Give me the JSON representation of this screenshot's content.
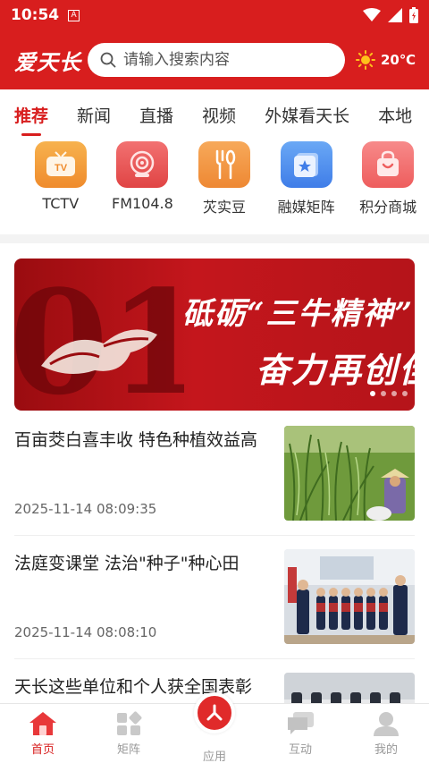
{
  "status_bar": {
    "time": "10:54",
    "notification_glyph": "A"
  },
  "header": {
    "logo_text": "爱天长",
    "search": {
      "placeholder": "请输入搜索内容",
      "value": ""
    },
    "weather": {
      "icon": "sun-icon",
      "temperature": "20℃"
    }
  },
  "tabs": [
    {
      "label": "推荐",
      "active": true
    },
    {
      "label": "新闻",
      "active": false
    },
    {
      "label": "直播",
      "active": false
    },
    {
      "label": "视频",
      "active": false
    },
    {
      "label": "外媒看天长",
      "active": false
    },
    {
      "label": "本地",
      "active": false
    }
  ],
  "apps": [
    {
      "label": "TCTV",
      "icon": "tv-icon",
      "color": "#f2993b"
    },
    {
      "label": "FM104.8",
      "icon": "radio-icon",
      "color": "#ea4f4f"
    },
    {
      "label": "苂实豆",
      "icon": "fork-spoon-icon",
      "color": "#f2994a"
    },
    {
      "label": "融媒矩阵",
      "icon": "star-card-icon",
      "color": "#4b8ff0"
    },
    {
      "label": "积分商城",
      "icon": "shopping-bag-icon",
      "color": "#f26b6b"
    }
  ],
  "banner": {
    "slogan_line1": "砥砺“三牛精神”",
    "slogan_line2": "奋力再创佳",
    "page_indicator": {
      "total": 4,
      "active": 1
    }
  },
  "news": [
    {
      "title": "百亩茭白喜丰收 特色种植效益高",
      "time": "2025-11-14 08:09:35",
      "thumb": "field-photo"
    },
    {
      "title": "法庭变课堂 法治\"种子\"种心田",
      "time": "2025-11-14 08:08:10",
      "thumb": "classroom-photo"
    },
    {
      "title": "天长这些单位和个人获全国表彰",
      "time": "",
      "thumb": "ceremony-photo"
    }
  ],
  "bottom_nav": [
    {
      "label": "首页",
      "icon": "home-icon",
      "active": true
    },
    {
      "label": "矩阵",
      "icon": "grid-icon",
      "active": false
    },
    {
      "label": "应用",
      "icon": "apps-center-icon",
      "active": false
    },
    {
      "label": "互动",
      "icon": "chat-icon",
      "active": false
    },
    {
      "label": "我的",
      "icon": "user-icon",
      "active": false
    }
  ],
  "colors": {
    "brand_red": "#d81e1e",
    "inactive_gray": "#999999"
  }
}
